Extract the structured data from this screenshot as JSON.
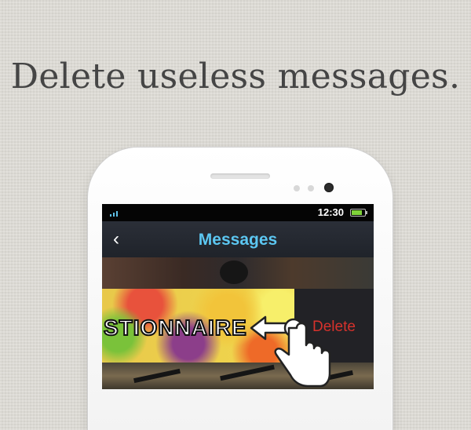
{
  "promo": {
    "headline": "Delete useless messages."
  },
  "statusbar": {
    "time": "12:30"
  },
  "navbar": {
    "back_glyph": "‹",
    "title": "Messages"
  },
  "message": {
    "text": "STIONNAIRE",
    "delete_label": "Delete"
  },
  "icons": [
    "signal-icon",
    "battery-icon",
    "back-arrow-icon",
    "swipe-hand-icon"
  ],
  "colors": {
    "accent": "#5cc7f2",
    "delete": "#d6322c",
    "background": "#dcdad4"
  }
}
